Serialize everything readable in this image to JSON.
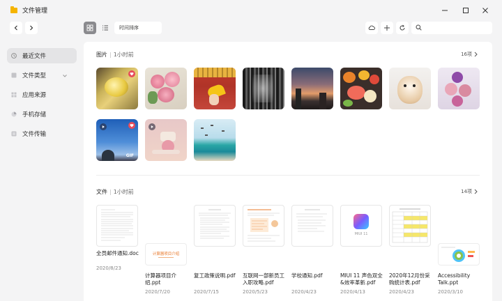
{
  "window": {
    "title": "文件管理"
  },
  "sidebar": {
    "items": [
      {
        "label": "最近文件",
        "icon": "clock-icon",
        "active": true
      },
      {
        "label": "文件类型",
        "icon": "file-type-icon",
        "active": false,
        "has_caret": true
      },
      {
        "label": "应用来源",
        "icon": "apps-icon",
        "active": false
      },
      {
        "label": "手机存储",
        "icon": "pie-icon",
        "active": false
      },
      {
        "label": "文件传输",
        "icon": "transfer-icon",
        "active": false
      }
    ]
  },
  "toolbar": {
    "sort_label": "时间排序",
    "search_placeholder": ""
  },
  "pictures": {
    "title": "图片",
    "time": "1小时前",
    "count": "16项",
    "items": [
      {
        "subject": "food dish",
        "favorite": true
      },
      {
        "subject": "pink flowers"
      },
      {
        "subject": "ginkgo leaf"
      },
      {
        "subject": "bw curtain"
      },
      {
        "subject": "sunset city"
      },
      {
        "subject": "fruit platter"
      },
      {
        "subject": "hamster"
      },
      {
        "subject": "purple flowers"
      },
      {
        "subject": "sky gif",
        "video": true,
        "favorite": true,
        "gif": "GIF"
      },
      {
        "subject": "dessert",
        "video": true
      },
      {
        "subject": "birds over sea"
      }
    ]
  },
  "files": {
    "title": "文件",
    "time": "1小时前",
    "count": "14项",
    "items": [
      {
        "name": "全员邮件通知.doc",
        "date": "2020/8/23"
      },
      {
        "name": "计算器项目介绍.ppt",
        "date": "2020/7/20",
        "cover_text": "计算器项目介绍"
      },
      {
        "name": "复工政策说明.pdf",
        "date": "2020/7/15"
      },
      {
        "name": "互联网一部新员工入职攻略.pdf",
        "date": "2020/5/23"
      },
      {
        "name": "学校通知.pdf",
        "date": "2020/4/23"
      },
      {
        "name": "MIUI 11 声色双全&效率革新.pdf",
        "date": "2020/4/13",
        "cover_text": "MIUI 11"
      },
      {
        "name": "2020年12月份采购统计表.pdf",
        "date": "2020/4/23"
      },
      {
        "name": "Accessibility Talk.ppt",
        "date": "2020/3/10"
      }
    ]
  }
}
